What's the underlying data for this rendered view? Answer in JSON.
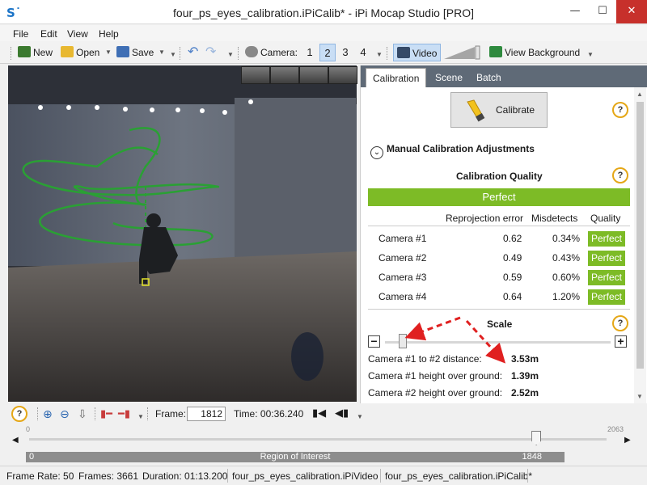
{
  "window": {
    "title": "four_ps_eyes_calibration.iPiCalib* - iPi Mocap Studio [PRO]",
    "app_icon": "S˙",
    "minimize": "—",
    "maximize": "☐",
    "close": "✕"
  },
  "menu": [
    "File",
    "Edit",
    "View",
    "Help"
  ],
  "toolbar": {
    "new_label": "New",
    "open_label": "Open",
    "save_label": "Save",
    "camera_label": "Camera:",
    "cameras": [
      "1",
      "2",
      "3",
      "4"
    ],
    "active_camera": "2",
    "video_label": "Video",
    "view_background_label": "View Background"
  },
  "panel": {
    "tabs": [
      "Calibration",
      "Scene",
      "Batch"
    ],
    "active_tab": "Calibration",
    "calibrate_label": "Calibrate",
    "help_glyph": "?",
    "manual_adjust_label": "Manual Calibration Adjustments",
    "quality_title": "Calibration Quality",
    "overall_quality": "Perfect",
    "columns": [
      "Reprojection error",
      "Misdetects",
      "Quality"
    ],
    "cameras": [
      {
        "name": "Camera #1",
        "error": "0.62",
        "misdetects": "0.34%",
        "quality": "Perfect"
      },
      {
        "name": "Camera #2",
        "error": "0.49",
        "misdetects": "0.43%",
        "quality": "Perfect"
      },
      {
        "name": "Camera #3",
        "error": "0.59",
        "misdetects": "0.60%",
        "quality": "Perfect"
      },
      {
        "name": "Camera #4",
        "error": "0.64",
        "misdetects": "1.20%",
        "quality": "Perfect"
      }
    ],
    "scale_title": "Scale",
    "scale_value": 0.08,
    "minus": "−",
    "plus": "+",
    "distances": [
      {
        "label": "Camera #1 to #2 distance:",
        "value": "3.53m"
      },
      {
        "label": "Camera #1 height over ground:",
        "value": "1.39m"
      },
      {
        "label": "Camera #2 height over ground:",
        "value": "2.52m"
      }
    ]
  },
  "frame_bar": {
    "frame_label": "Frame:",
    "frame_value": "1812",
    "time_label": "Time: 00:36.240"
  },
  "timeline": {
    "start": "0",
    "end": "2063",
    "position": 1812,
    "max": 2063,
    "roi_label": "Region of Interest",
    "roi_start": "0",
    "roi_end": "1848"
  },
  "status": {
    "frame_rate": "Frame Rate: 50",
    "frames": "Frames: 3661",
    "duration": "Duration: 01:13.200",
    "video_file": "four_ps_eyes_calibration.iPiVideo",
    "calib_file": "four_ps_eyes_calibration.iPiCalib*"
  },
  "colors": {
    "quality_green": "#7dbb26",
    "close_red": "#c7302b",
    "help_ring": "#e5a716",
    "annotation_arrow": "#e02020"
  }
}
